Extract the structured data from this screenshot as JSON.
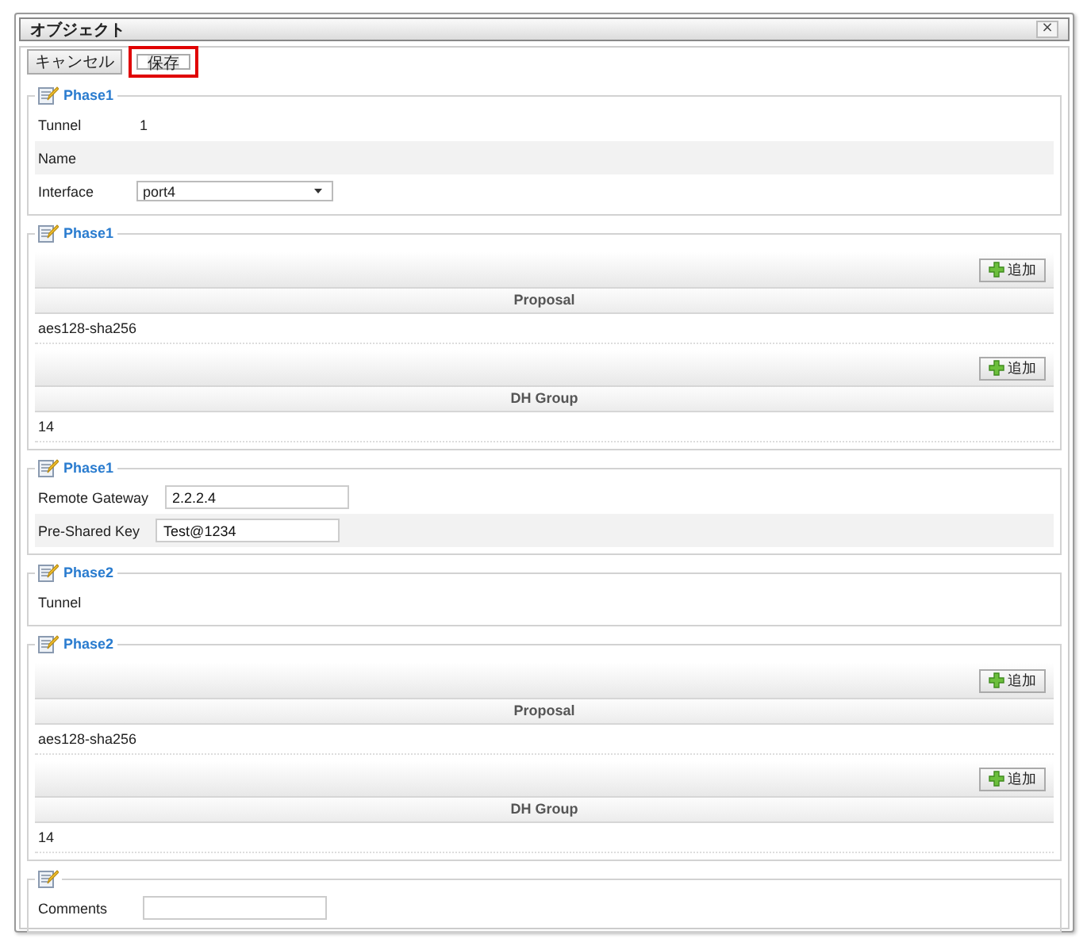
{
  "window": {
    "title": "オブジェクト",
    "close": "×"
  },
  "toolbar": [
    {
      "label": "キャンセル",
      "highlighted": false
    },
    {
      "label": "保存",
      "highlighted": true
    }
  ],
  "sections": [
    {
      "kind": "form",
      "legend": "Phase1",
      "rows": [
        {
          "kind": "text",
          "label": "Tunnel",
          "value": "1",
          "shaded": false
        },
        {
          "kind": "text",
          "label": "Name",
          "shaded": true
        },
        {
          "kind": "select",
          "label": "Interface",
          "value": "port4",
          "shaded": false
        }
      ]
    },
    {
      "kind": "tables",
      "legend": "Phase1",
      "tables": [
        {
          "add": "追加",
          "header": "Proposal",
          "rows": [
            "aes128-sha256"
          ]
        },
        {
          "add": "追加",
          "header": "DH Group",
          "rows": [
            "14"
          ]
        }
      ]
    },
    {
      "kind": "form",
      "legend": "Phase1",
      "rows": [
        {
          "kind": "input",
          "label": "Remote Gateway",
          "value": "2.2.2.4",
          "shaded": false
        },
        {
          "kind": "input",
          "label": "Pre-Shared Key",
          "value": "Test@1234",
          "shaded": true
        }
      ]
    },
    {
      "kind": "form",
      "legend": "Phase2",
      "rows": [
        {
          "kind": "text",
          "label": "Tunnel",
          "shaded": false
        }
      ]
    },
    {
      "kind": "tables",
      "legend": "Phase2",
      "tables": [
        {
          "add": "追加",
          "header": "Proposal",
          "rows": [
            "aes128-sha256"
          ]
        },
        {
          "add": "追加",
          "header": "DH Group",
          "rows": [
            "14"
          ]
        }
      ]
    },
    {
      "kind": "form",
      "rows": [
        {
          "kind": "input",
          "label": "Comments",
          "shaded": false
        }
      ]
    }
  ]
}
